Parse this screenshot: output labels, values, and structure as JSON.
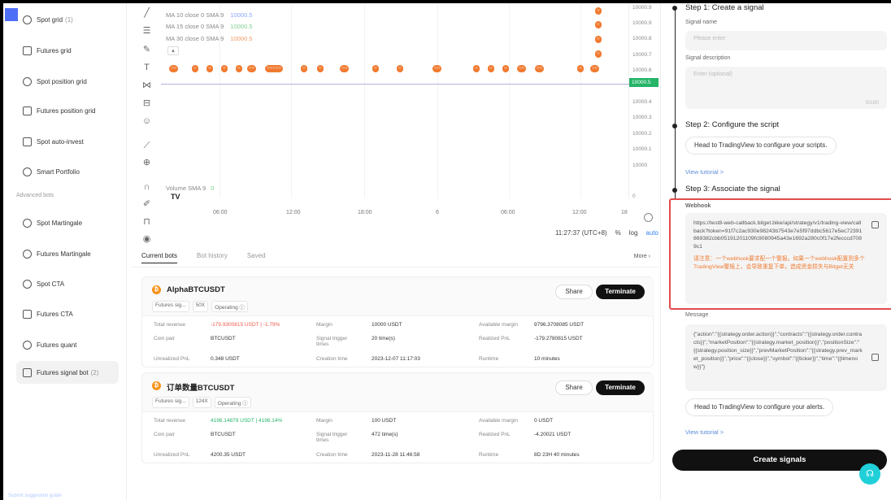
{
  "sidebar": {
    "items": [
      {
        "label": "Spot grid",
        "count": "(1)",
        "icon": "grid-icon"
      },
      {
        "label": "Futures grid",
        "count": "",
        "icon": "futures-grid-icon"
      },
      {
        "label": "Spot position grid",
        "count": "",
        "icon": "position-grid-icon"
      },
      {
        "label": "Futures position grid",
        "count": "",
        "icon": "futures-position-grid-icon"
      },
      {
        "label": "Spot auto-invest",
        "count": "",
        "icon": "auto-invest-icon"
      },
      {
        "label": "Smart Portfolio",
        "count": "",
        "icon": "portfolio-icon"
      }
    ],
    "section_label": "Advanced bots",
    "advanced_items": [
      {
        "label": "Spot Martingale",
        "count": "",
        "icon": "martingale-icon"
      },
      {
        "label": "Futures Martingale",
        "count": "",
        "icon": "futures-martingale-icon"
      },
      {
        "label": "Spot CTA",
        "count": "",
        "icon": "cta-icon"
      },
      {
        "label": "Futures CTA",
        "count": "",
        "icon": "futures-cta-icon"
      },
      {
        "label": "Futures quant",
        "count": "",
        "icon": "quant-icon"
      },
      {
        "label": "Futures signal bot",
        "count": "(2)",
        "icon": "signal-bot-icon"
      }
    ],
    "bottom_link": "Submit suggestion guide"
  },
  "chart": {
    "ma_lines": [
      {
        "label": "MA 10 close 0 SMA 9",
        "value": "10000.5",
        "color": "#8aa8ff"
      },
      {
        "label": "MA 15 close 0 SMA 9",
        "value": "10000.5",
        "color": "#7fcf8e"
      },
      {
        "label": "MA 30 close 0 SMA 9",
        "value": "10000.5",
        "color": "#f49a6b"
      }
    ],
    "prices": [
      "10000.9",
      "10000.8",
      "10000.7",
      "10000.6",
      "10000.4",
      "10000.3",
      "10000.2",
      "10000.1",
      "10000",
      "0"
    ],
    "current_price": "10000.5",
    "volume_label": "Volume SMA 9",
    "volume_value": "0",
    "tv_logo": "TV",
    "time_labels": [
      "06:00",
      "12:00",
      "18:00",
      "6",
      "06:00",
      "12:00",
      "18"
    ],
    "clock": "11:27:37 (UTC+8)",
    "pct": "%",
    "log": "log",
    "auto": "auto"
  },
  "bots": {
    "tabs": [
      "Current bots",
      "Bot history",
      "Saved"
    ],
    "more": "More",
    "share_label": "Share",
    "terminate_label": "Terminate",
    "labels": {
      "total_revenue": "Total revenue",
      "coin_pair": "Coin pair",
      "unrealized_pnl": "Unrealized PnL",
      "margin": "Margin",
      "signal_trigger": "Signal trigger times",
      "creation_time": "Creation time",
      "available_margin": "Available margin",
      "realized_pnl": "Realized PnL",
      "runtime": "Runtime"
    },
    "cards": [
      {
        "title": "AlphaBTCUSDT",
        "tags": [
          "Futures sig...",
          "50X",
          "Operating ⓘ"
        ],
        "total_revenue": "-179.9300815 USDT | -1.79%",
        "coin_pair": "BTCUSDT",
        "unrealized_pnl": "0.348 USDT",
        "margin": "10000 USDT",
        "signal_trigger": "20 time(s)",
        "creation_time": "2023-12-07 11:17:03",
        "available_margin": "9796.3708085 USDT",
        "realized_pnl": "-179.2780815 USDT",
        "runtime": "10 minutes"
      },
      {
        "title": "订单数量BTCUSDT",
        "tags": [
          "Futures sig...",
          "124X",
          "Operating ⓘ"
        ],
        "total_revenue": "4196.14879 USDT | 4196.14%",
        "coin_pair": "BTCUSDT",
        "unrealized_pnl": "4200.35 USDT",
        "margin": "100 USDT",
        "signal_trigger": "472 time(s)",
        "creation_time": "2023-11-28 11:46:58",
        "available_margin": "0 USDT",
        "realized_pnl": "-4.20021 USDT",
        "runtime": "8D 23H 40 minutes"
      }
    ]
  },
  "signal": {
    "step1": "Step 1: Create a signal",
    "name_label": "Signal name",
    "name_placeholder": "Please enter",
    "desc_label": "Signal description",
    "desc_placeholder": "Enter (optional)",
    "desc_counter": "0/180",
    "step2": "Step 2: Configure the script",
    "step2_button": "Head to TradingView to configure your scripts.",
    "view_tutorial": "View tutorial >",
    "step3": "Step 3: Associate the signal",
    "webhook_label": "Webhook",
    "webhook_url": "https://test8-web-callback.bitget.bike/api/strategy/v1/trading-view/callback?token=91f7c2ac930e98243b7543e7e5f97ddbc5617e5ec72391869382cbb05191201109fc9080945a43e1692a280c0f17e2fecccd7089c1",
    "webhook_warning": "请注意：一个webhook要求配一个警报。如果一个webhook配置到多个TradingView警报上，会导致重复下单，造成资金损失与Bitget无关",
    "message_label": "Message",
    "message_text": "{\"action\":\"{{strategy.order.action}}\",\"contracts\":\"{{strategy.order.contracts}}\",\"marketPosition\":\"{{strategy.market_position}}\",\"positionSize\":\"{{strategy.position_size}}\",\"prevMarketPosition\":\"{{strategy.prev_market_position}}\",\"price\":\"{{close}}\",\"symbol\":\"{{ticker}}\",\"time\":\"{{timenow}}\"}",
    "alerts_button": "Head to TradingView to configure your alerts.",
    "view_tutorial2": "View tutorial >",
    "create_button": "Create signals"
  }
}
